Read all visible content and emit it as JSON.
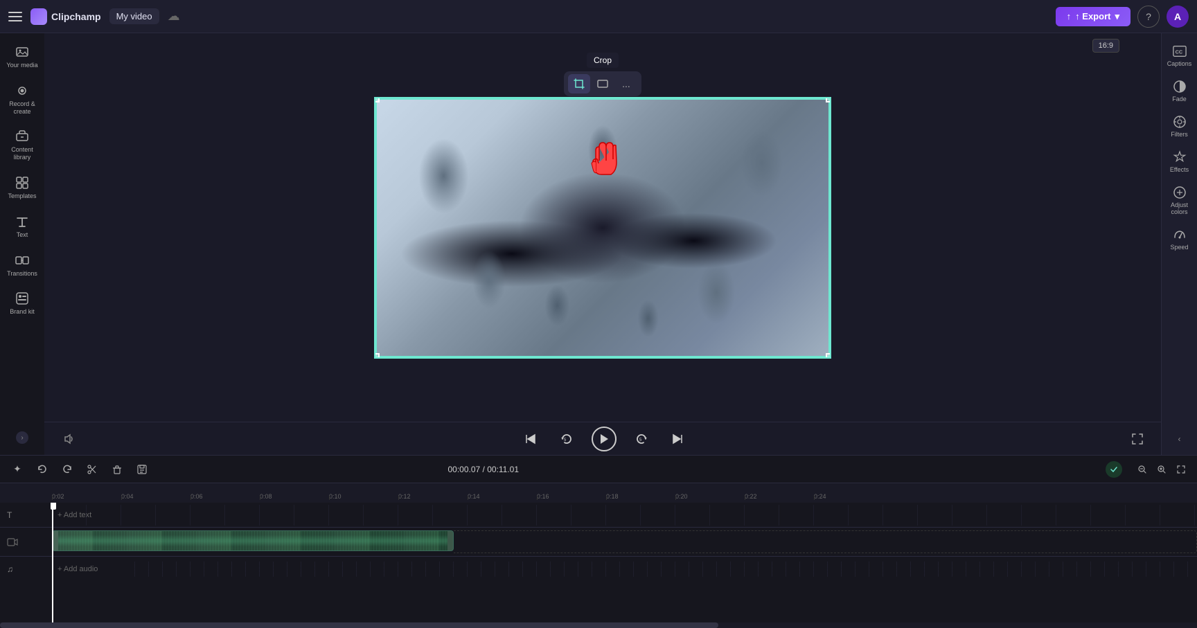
{
  "app": {
    "name": "Clipchamp",
    "logo_text": "Clipchamp"
  },
  "topbar": {
    "menu_icon": "☰",
    "video_title": "My video",
    "export_label": "↑ Export",
    "help_label": "?",
    "avatar_label": "A"
  },
  "sidebar": {
    "items": [
      {
        "id": "your-media",
        "label": "Your media",
        "icon": "media"
      },
      {
        "id": "record-create",
        "label": "Record &\ncreate",
        "icon": "record"
      },
      {
        "id": "content-library",
        "label": "Content\nlibrary",
        "icon": "library"
      },
      {
        "id": "templates",
        "label": "Templates",
        "icon": "templates"
      },
      {
        "id": "text",
        "label": "Text",
        "icon": "text"
      },
      {
        "id": "transitions",
        "label": "Transitions",
        "icon": "transitions"
      },
      {
        "id": "brand-kit",
        "label": "Brand kit",
        "icon": "brand"
      }
    ]
  },
  "crop_toolbar": {
    "tooltip": "Crop",
    "crop_btn": "crop",
    "aspect_btn": "aspect",
    "more_btn": "..."
  },
  "right_panel": {
    "aspect_ratio": "16:9",
    "items": [
      {
        "id": "captions",
        "label": "Captions",
        "icon": "CC"
      },
      {
        "id": "fade",
        "label": "Fade",
        "icon": "fade"
      },
      {
        "id": "filters",
        "label": "Filters",
        "icon": "filters"
      },
      {
        "id": "effects",
        "label": "Effects",
        "icon": "effects"
      },
      {
        "id": "adjust-colors",
        "label": "Adjust\ncolors",
        "icon": "adjust"
      },
      {
        "id": "speed",
        "label": "Speed",
        "icon": "speed"
      }
    ]
  },
  "playback": {
    "skip_back": "⏮",
    "rewind": "↺",
    "play": "▶",
    "forward": "↻",
    "skip_forward": "⏭",
    "fullscreen": "⛶"
  },
  "timeline": {
    "toolbar": {
      "sparkle": "✦",
      "undo": "↩",
      "redo": "↪",
      "cut": "✂",
      "delete": "🗑",
      "save": "💾"
    },
    "time_display": "00:00.07 / 00:11.01",
    "zoom_out": "−",
    "zoom_in": "+",
    "expand": "⤢",
    "ruler_marks": [
      "0:02",
      "0:04",
      "0:06",
      "0:08",
      "0:10",
      "0:12",
      "0:14",
      "0:16",
      "0:18",
      "0:20",
      "0:22",
      "0:24"
    ],
    "tracks": [
      {
        "type": "text",
        "label": "T",
        "add_label": "+ Add text"
      },
      {
        "type": "video",
        "label": "video"
      },
      {
        "type": "audio",
        "label": "♫",
        "add_label": "+ Add audio"
      }
    ]
  }
}
